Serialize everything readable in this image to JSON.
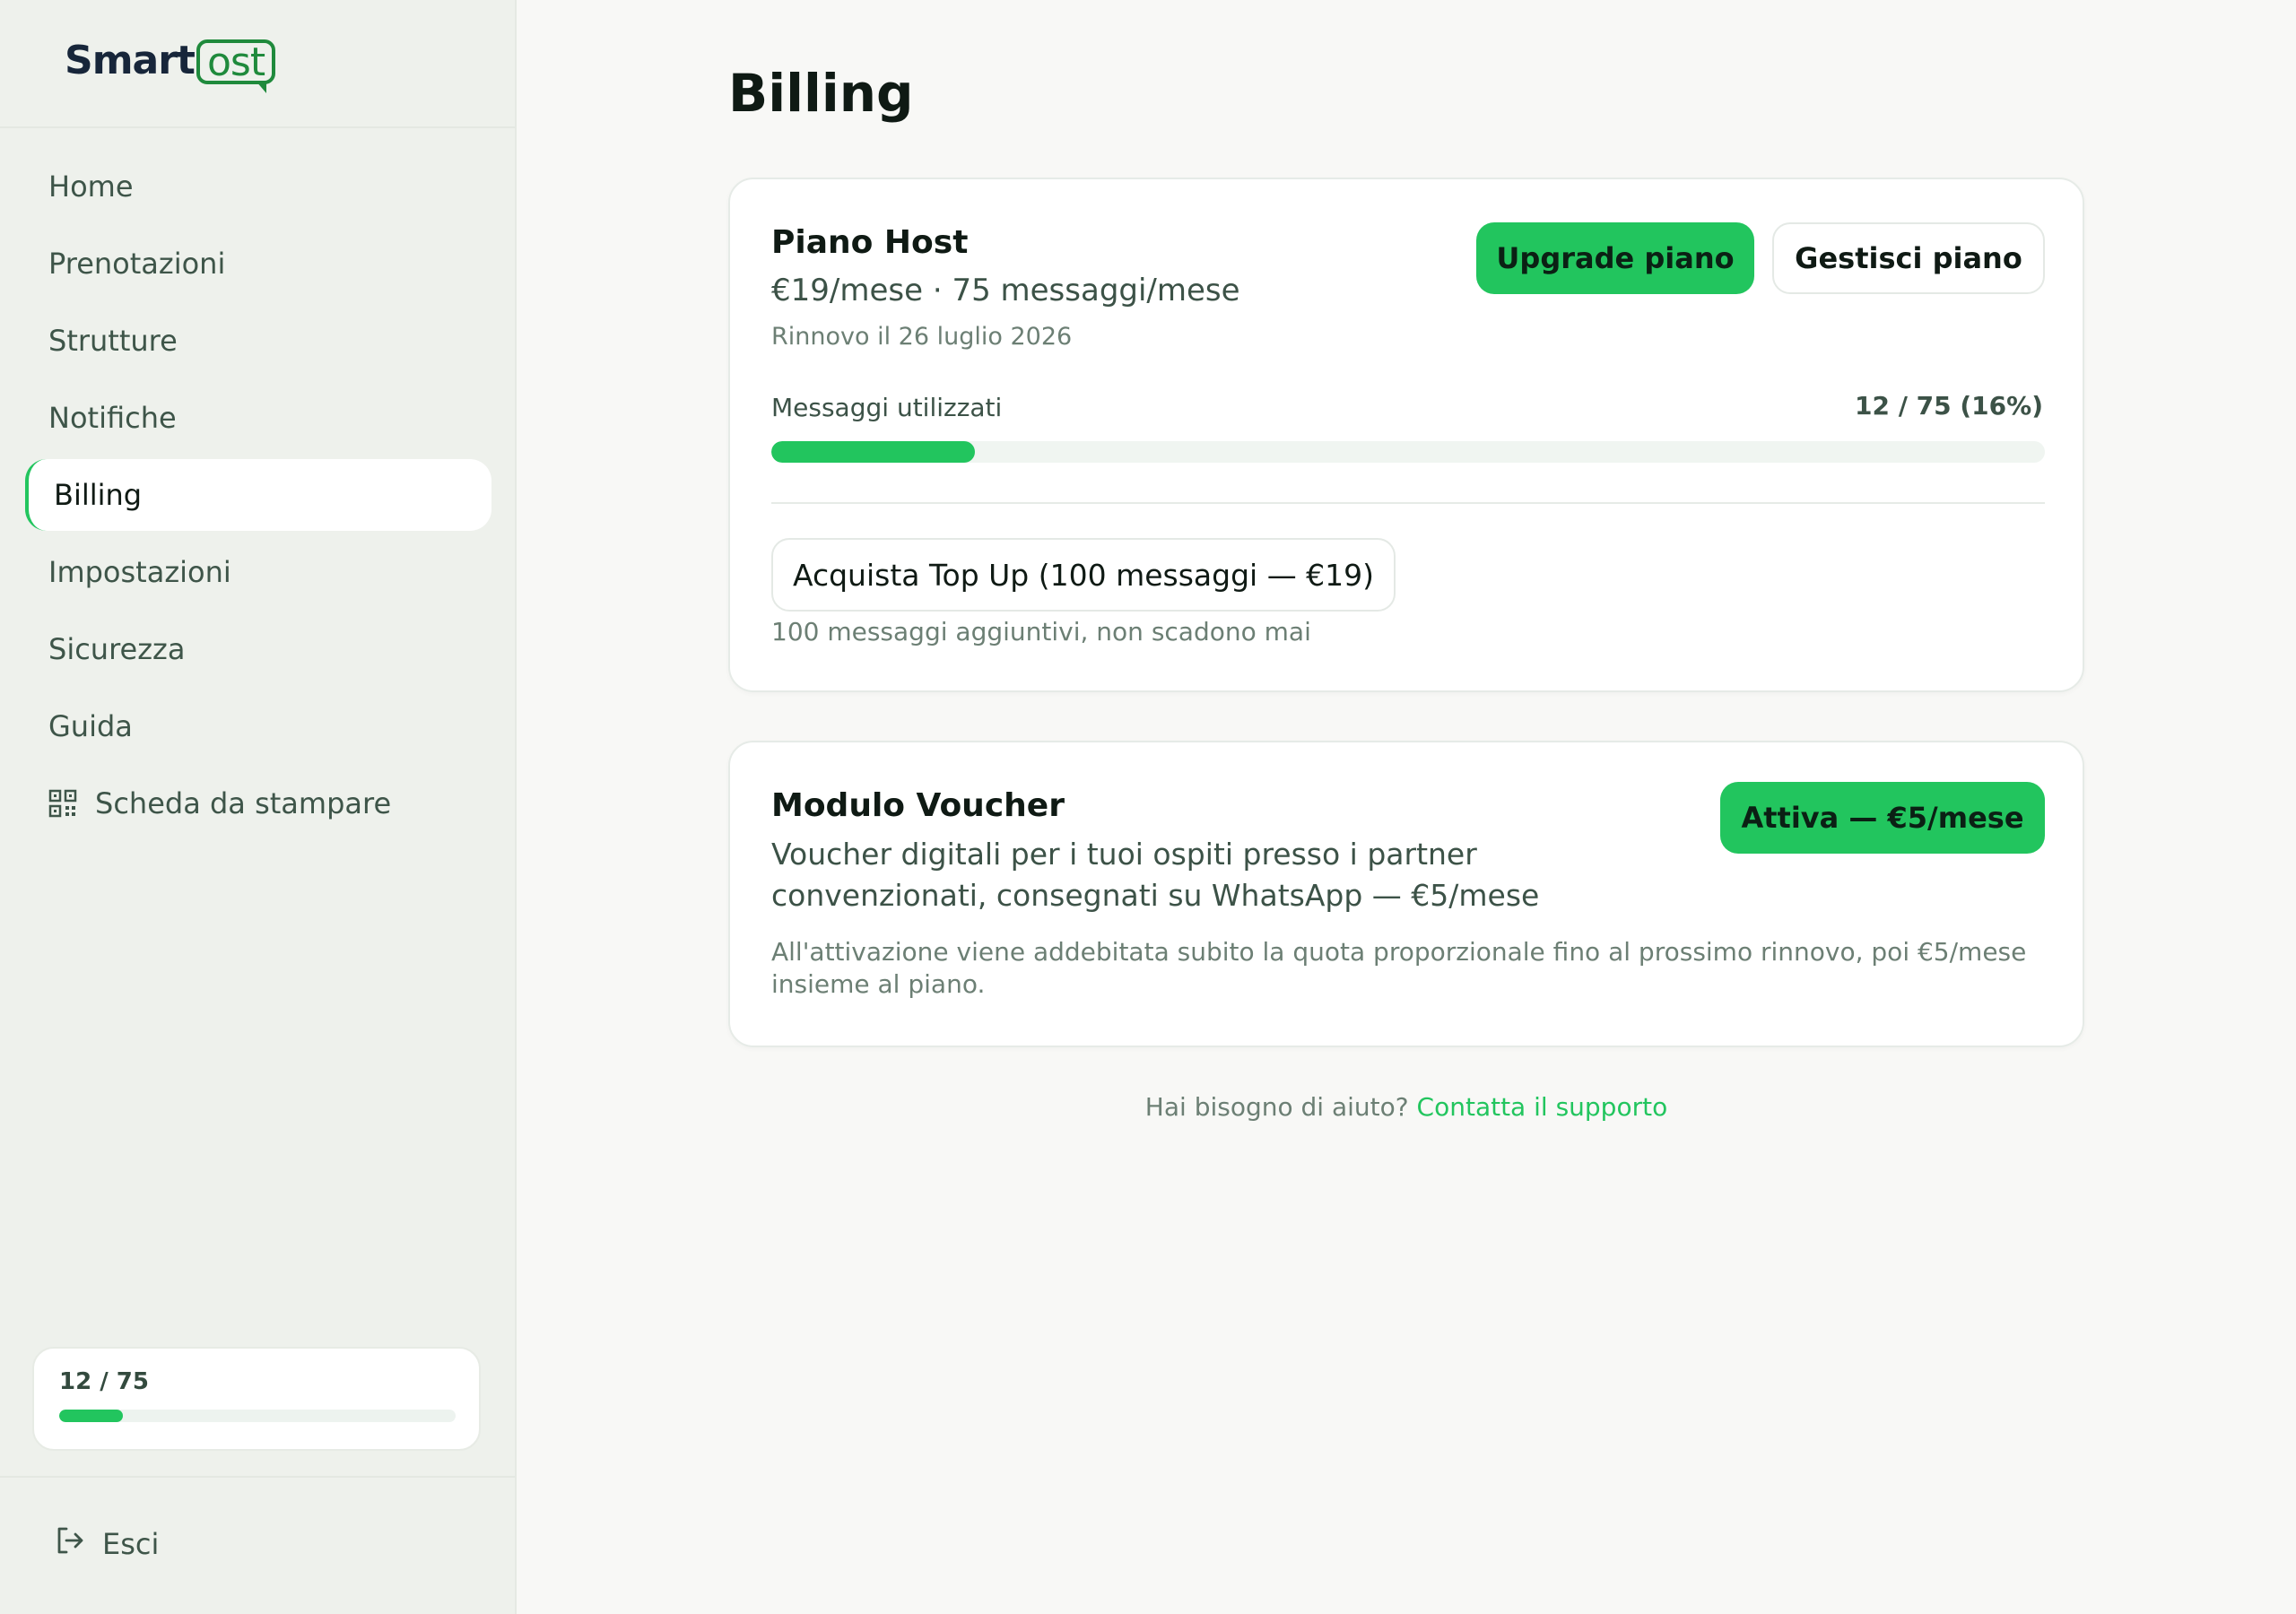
{
  "brand": {
    "logo_main": "Smart",
    "logo_bubble": "ost"
  },
  "sidebar": {
    "items": [
      {
        "label": "Home",
        "icon": ""
      },
      {
        "label": "Prenotazioni",
        "icon": ""
      },
      {
        "label": "Strutture",
        "icon": ""
      },
      {
        "label": "Notifiche",
        "icon": ""
      },
      {
        "label": "Billing",
        "icon": "",
        "active": true
      },
      {
        "label": "Impostazioni",
        "icon": ""
      },
      {
        "label": "Sicurezza",
        "icon": ""
      },
      {
        "label": "Guida",
        "icon": ""
      },
      {
        "label": "Scheda da stampare",
        "icon": "qr-code-icon"
      }
    ],
    "usage": {
      "label": "12 / 75",
      "used": 12,
      "total": 75
    },
    "logout_label": "Esci"
  },
  "page": {
    "title": "Billing"
  },
  "plan": {
    "name": "Piano Host",
    "price": "€19/mese · 75 messaggi/mese",
    "renewal": "Rinnovo il 26 luglio 2026",
    "upgrade_label": "Upgrade piano",
    "manage_label": "Gestisci piano",
    "usage_label": "Messaggi utilizzati",
    "usage_value": "12 / 75 (16%)",
    "usage_fraction": 0.16,
    "topup_label": "Acquista Top Up (100 messaggi — €19)",
    "topup_note": "100 messaggi aggiuntivi, non scadono mai"
  },
  "voucher": {
    "title": "Modulo Voucher",
    "description": "Voucher digitali per i tuoi ospiti presso i partner convenzionati, consegnati su WhatsApp — €5/mese",
    "activate_label": "Attiva — €5/mese",
    "note": "All'attivazione viene addebitata subito la quota proporzionale fino al prossimo rinnovo, poi €5/mese insieme al piano."
  },
  "help": {
    "text": "Hai bisogno di aiuto?",
    "link": "Contatta il supporto"
  },
  "colors": {
    "accent": "#22c55e",
    "sidebar_bg": "#eef1ec",
    "page_bg": "#f8f8f6",
    "logo_green": "#1f8a3c",
    "logo_dark": "#17263a"
  }
}
